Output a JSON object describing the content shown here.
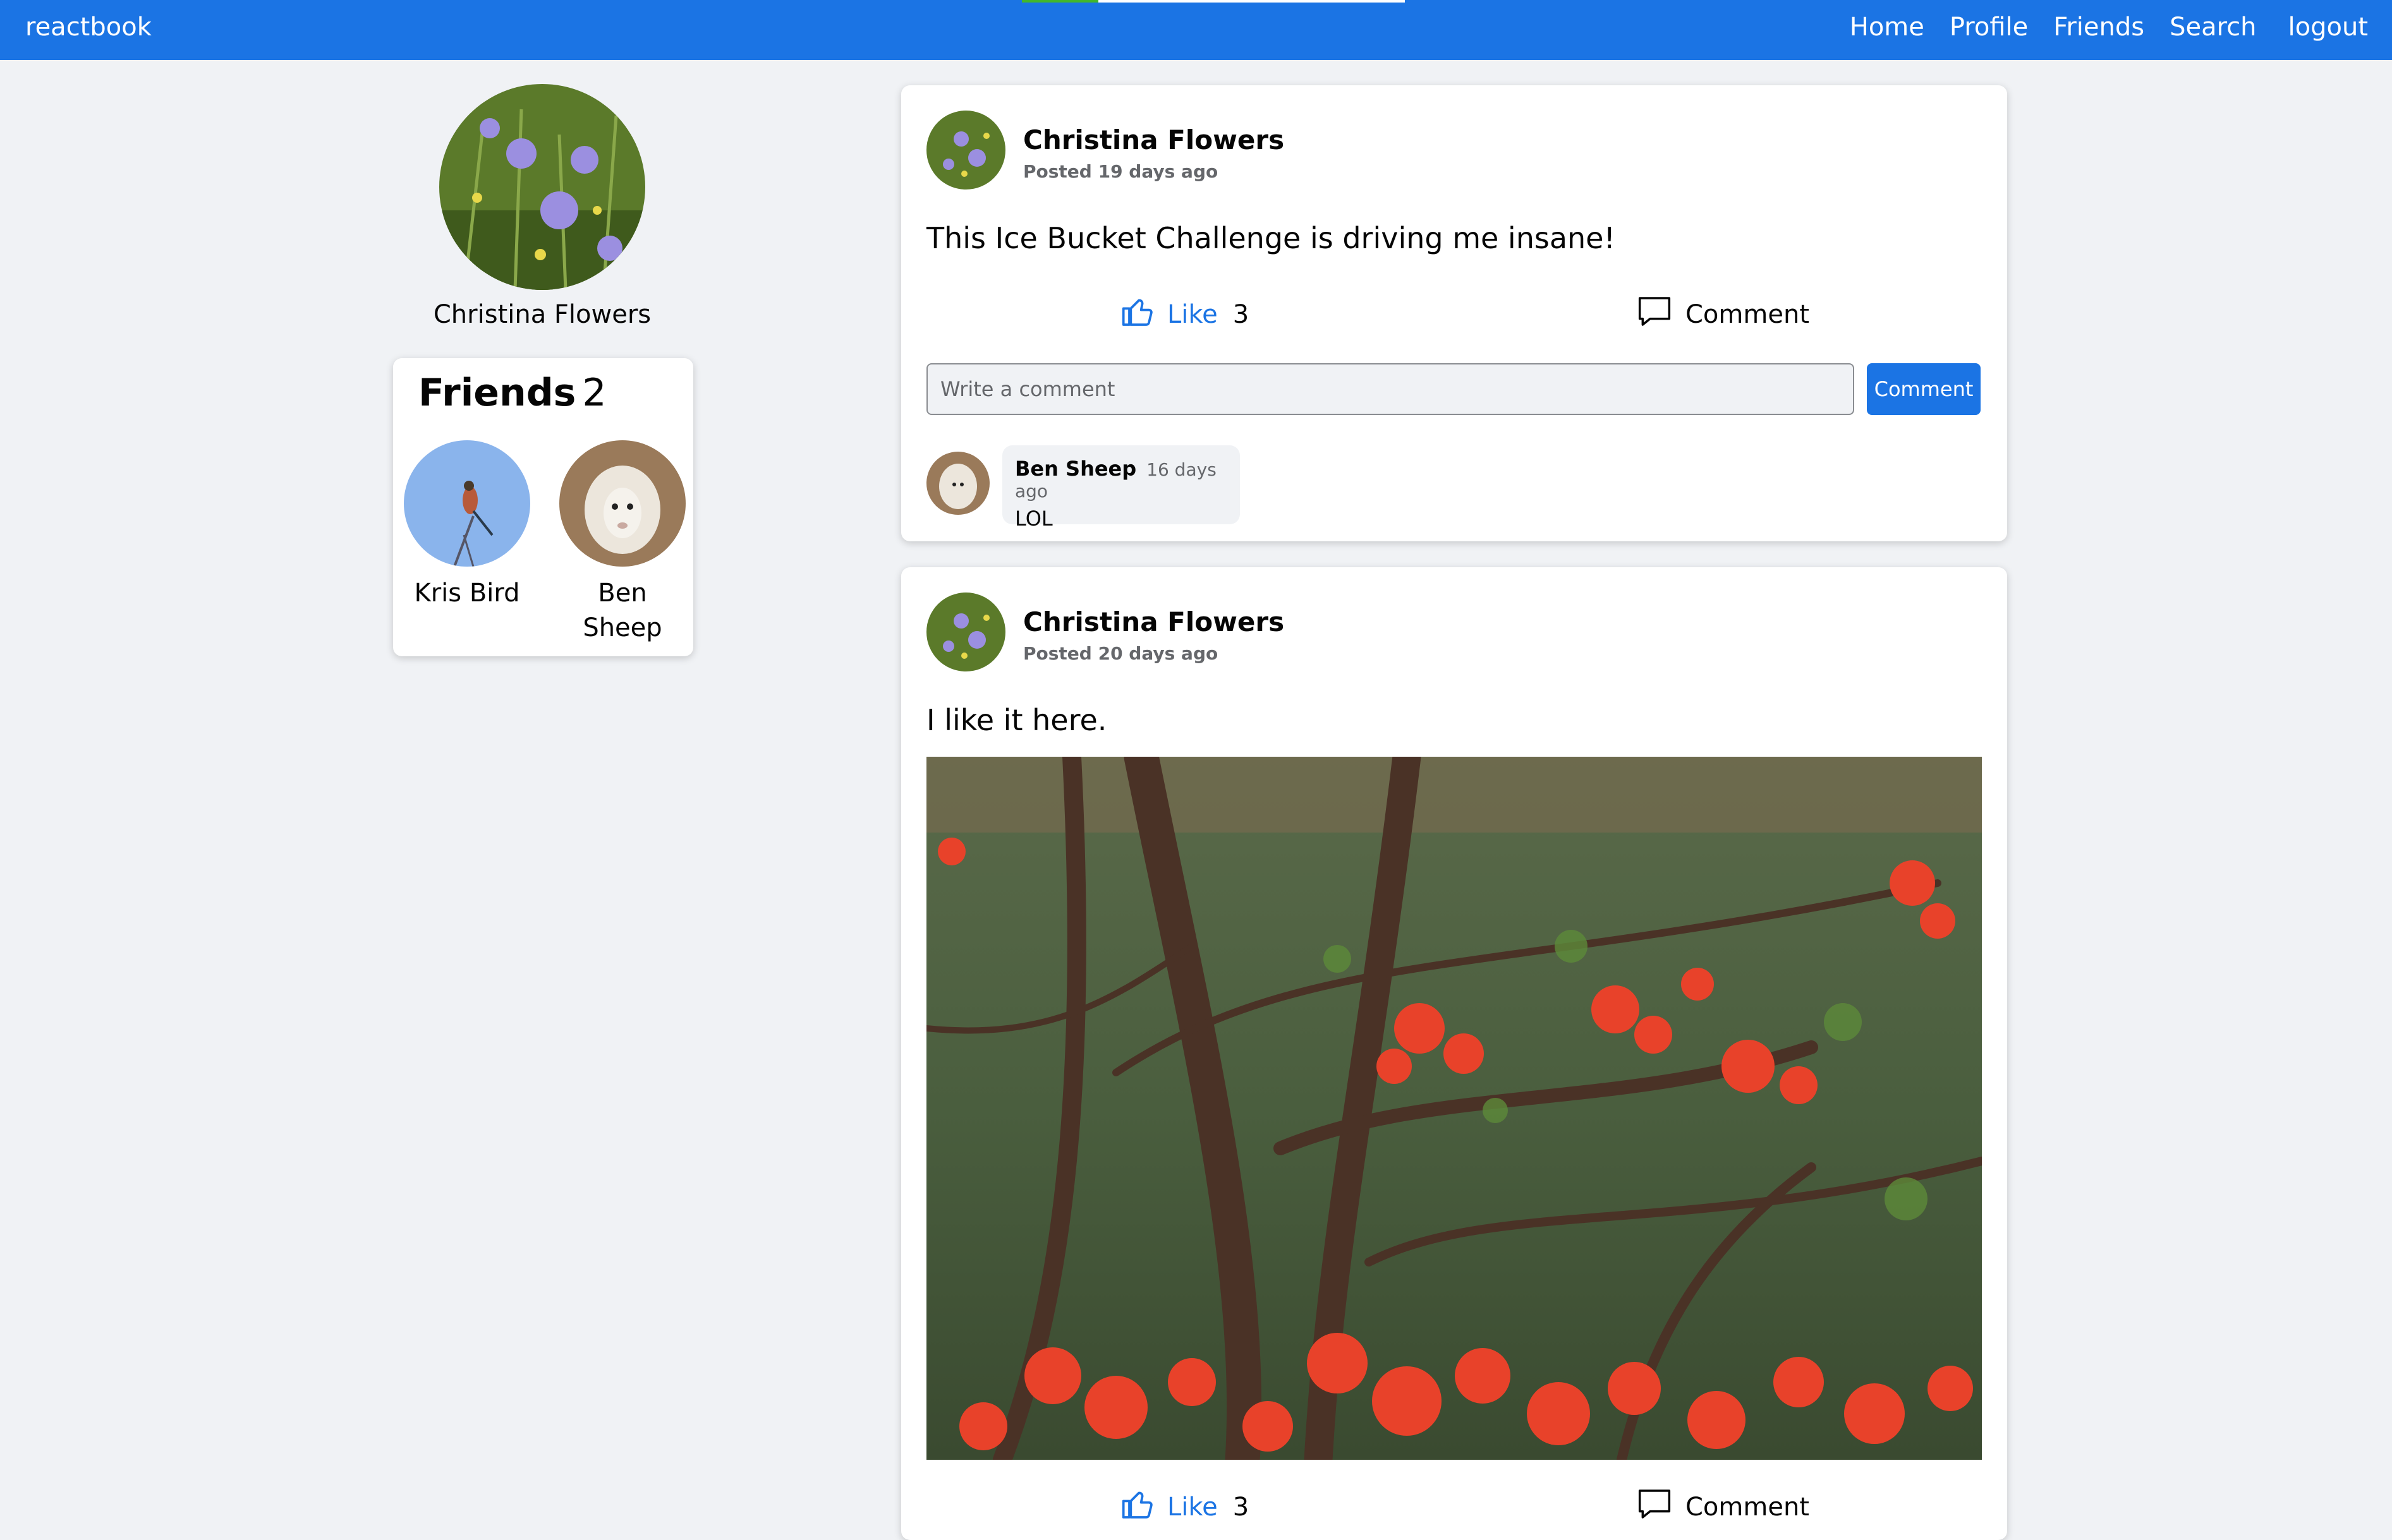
{
  "app": {
    "brand": "reactbook"
  },
  "nav": {
    "home": "Home",
    "profile": "Profile",
    "friends": "Friends",
    "search": "Search",
    "logout": "logout"
  },
  "progress": {
    "fraction": 0.2
  },
  "profile": {
    "name": "Christina Flowers"
  },
  "friends_card": {
    "title": "Friends",
    "count": "2",
    "friends": [
      {
        "name": "Kris Bird"
      },
      {
        "name": "Ben Sheep"
      }
    ]
  },
  "posts": [
    {
      "author": "Christina Flowers",
      "time": "Posted 19 days ago",
      "text": "This Ice Bucket Challenge is driving me insane!",
      "like_label": "Like",
      "like_count": "3",
      "comment_label": "Comment",
      "comment_placeholder": "Write a comment",
      "comment_submit": "Comment",
      "comments": [
        {
          "author": "Ben Sheep",
          "time": "16 days ago",
          "text": "LOL"
        }
      ]
    },
    {
      "author": "Christina Flowers",
      "time": "Posted 20 days ago",
      "text": "I like it here.",
      "like_label": "Like",
      "like_count": "3",
      "comment_label": "Comment"
    }
  ],
  "colors": {
    "brand_blue": "#1b74e4",
    "background": "#f0f2f5",
    "progress_green": "#42b72a"
  },
  "icons": [
    "thumbs-up-icon",
    "comment-bubble-icon"
  ]
}
